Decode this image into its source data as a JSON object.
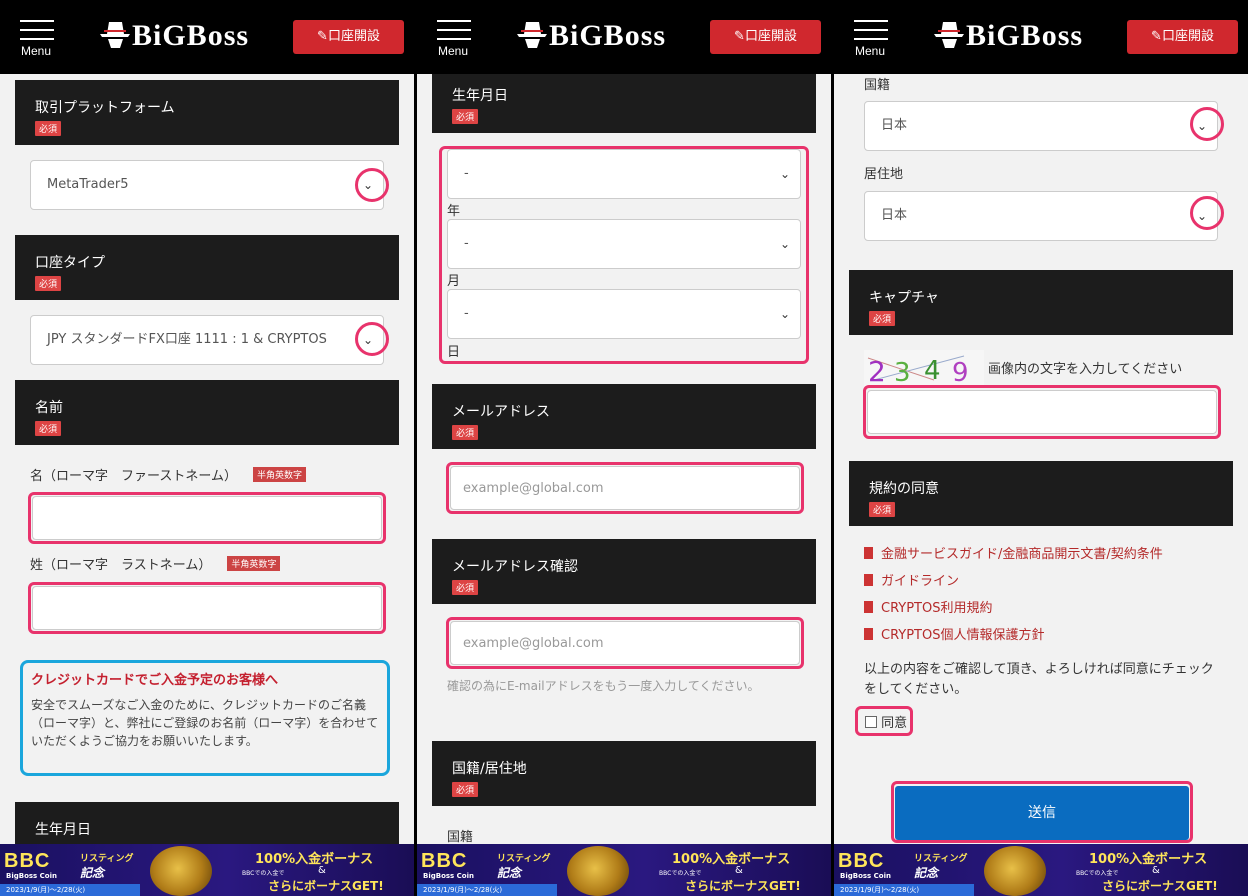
{
  "header": {
    "menu_label": "Menu",
    "logo_text": "BiGBoss",
    "open_account": "口座開設"
  },
  "panel1": {
    "platform_title": "取引プラットフォーム",
    "platform_value": "MetaTrader5",
    "account_type_title": "口座タイプ",
    "account_type_value": "JPY スタンダードFX口座 1111 : 1 & CRYPTOS",
    "name_title": "名前",
    "first_name_label": "名（ローマ字　ファーストネーム）",
    "last_name_label": "姓（ローマ字　ラストネーム）",
    "alnum_tag": "半角英数字",
    "note_title": "クレジットカードでご入金予定のお客様へ",
    "note_body": "安全でスムーズなご入金のために、クレジットカードのご名義（ローマ字）と、弊社にご登録のお名前（ローマ字）を合わせていただくようご協力をお願いいたします。",
    "dob_title": "生年月日"
  },
  "panel2": {
    "dob_title": "生年月日",
    "year_value": "-",
    "year_label": "年",
    "month_value": "-",
    "month_label": "月",
    "day_value": "-",
    "day_label": "日",
    "email_title": "メールアドレス",
    "email_placeholder": "example@global.com",
    "email_confirm_title": "メールアドレス確認",
    "email_confirm_placeholder": "example@global.com",
    "email_confirm_help": "確認の為にE-mailアドレスをもう一度入力してください。",
    "nationality_title": "国籍/居住地",
    "nationality_label": "国籍"
  },
  "panel3": {
    "nationality_label": "国籍",
    "nationality_value": "日本",
    "residence_label": "居住地",
    "residence_value": "日本",
    "captcha_title": "キャプチャ",
    "captcha_text": "2349",
    "captcha_instruction": "画像内の文字を入力してください",
    "terms_title": "規約の同意",
    "docs": [
      "金融サービスガイド/金融商品開示文書/契約条件",
      "ガイドライン",
      "CRYPTOS利用規約",
      "CRYPTOS個人情報保護方針"
    ],
    "consent_text": "以上の内容をご確認して頂き、よろしければ同意にチェックをしてください。",
    "agree_label": "同意",
    "submit_label": "送信"
  },
  "required_label": "必須",
  "banner": {
    "brand": "BBC",
    "brand_sub": "BigBoss Coin",
    "listing": "リスティング",
    "kinen": "記念",
    "bonus": "100%入金ボーナス",
    "amp": "&",
    "note": "BBCでの入金で",
    "more": "さらにボーナスGET!",
    "dates": "2023/1/9(月)～2/28(火)"
  },
  "colors": {
    "accent_red": "#d0282e",
    "highlight_pink": "#e8336c",
    "note_blue": "#1ba6dc",
    "submit_blue": "#0a6cc0"
  }
}
